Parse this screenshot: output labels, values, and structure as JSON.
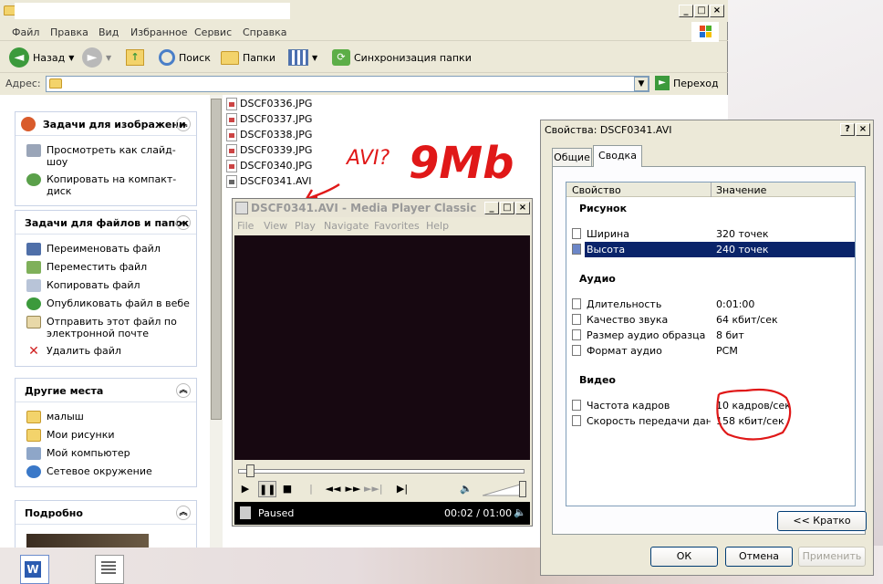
{
  "explorer": {
    "menu": [
      "Файл",
      "Правка",
      "Вид",
      "Избранное",
      "Сервис",
      "Справка"
    ],
    "toolbar": {
      "back": "Назад",
      "search": "Поиск",
      "folders": "Папки",
      "sync": "Синхронизация папки"
    },
    "address": {
      "label": "Адрес:",
      "go": "Переход"
    },
    "panels": {
      "image_tasks": {
        "title": "Задачи для изображени",
        "items": [
          "Просмотреть как слайд-шоу",
          "Копировать на компакт-диск"
        ]
      },
      "file_tasks": {
        "title": "Задачи для файлов и папок",
        "items": [
          "Переименовать файл",
          "Переместить файл",
          "Копировать файл",
          "Опубликовать файл в вебе",
          "Отправить этот файл по электронной почте",
          "Удалить файл"
        ]
      },
      "other_places": {
        "title": "Другие места",
        "items": [
          "малыш",
          "Мои рисунки",
          "Мой компьютер",
          "Сетевое окружение"
        ]
      },
      "details": {
        "title": "Подробно"
      }
    },
    "files": [
      "DSCF0336.JPG",
      "DSCF0337.JPG",
      "DSCF0338.JPG",
      "DSCF0339.JPG",
      "DSCF0340.JPG",
      "DSCF0341.AVI"
    ]
  },
  "annotation": {
    "text1": "AVI?",
    "text2": "9Mb"
  },
  "player": {
    "title": "DSCF0341.AVI - Media Player Classic",
    "menu": [
      "File",
      "View",
      "Play",
      "Navigate",
      "Favorites",
      "Help"
    ],
    "status": "Paused",
    "time": "00:02 / 01:00",
    "seek_position": 0.03,
    "volume": 1.0
  },
  "properties": {
    "title": "Свойства: DSCF0341.AVI",
    "tabs": [
      "Общие",
      "Сводка"
    ],
    "columns": [
      "Свойство",
      "Значение"
    ],
    "sections": {
      "image": "Рисунок",
      "audio": "Аудио",
      "video": "Видео"
    },
    "rows": {
      "width": {
        "name": "Ширина",
        "value": "320 точек"
      },
      "height": {
        "name": "Высота",
        "value": "240 точек"
      },
      "duration": {
        "name": "Длительность",
        "value": "0:01:00"
      },
      "audio_quality": {
        "name": "Качество звука",
        "value": "64 кбит/сек"
      },
      "sample_size": {
        "name": "Размер аудио образца",
        "value": "8 бит"
      },
      "audio_format": {
        "name": "Формат аудио",
        "value": "PCM"
      },
      "frame_rate": {
        "name": "Частота кадров",
        "value": "10 кадров/сек"
      },
      "data_rate": {
        "name": "Скорость передачи дан...",
        "value": "158 кбит/сек"
      }
    },
    "simple_btn": "<< Кратко",
    "ok": "ОК",
    "cancel": "Отмена",
    "apply": "Применить"
  }
}
